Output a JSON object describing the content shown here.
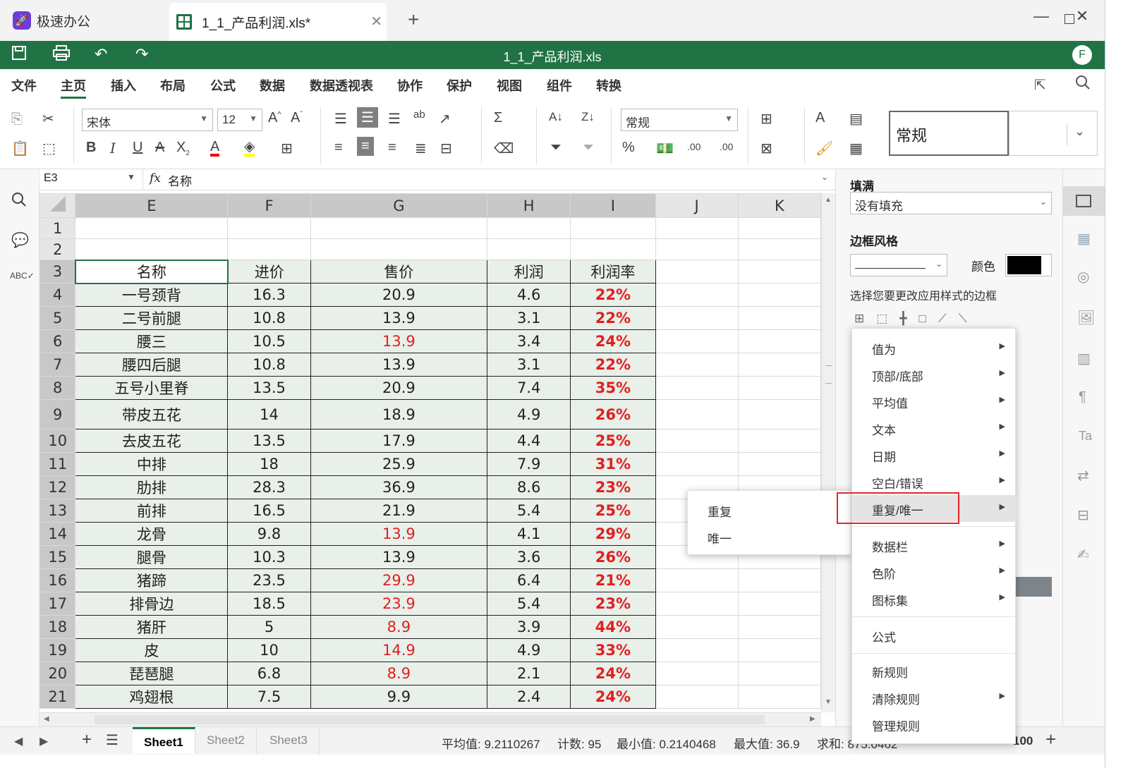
{
  "tabs": {
    "app_name": "极速办公",
    "doc_name": "1_1_产品利润.xls*"
  },
  "titlebar": {
    "title": "1_1_产品利润.xls",
    "avatar": "F"
  },
  "menu": [
    "文件",
    "主页",
    "插入",
    "布局",
    "公式",
    "数据",
    "数据透视表",
    "协作",
    "保护",
    "视图",
    "组件",
    "转换"
  ],
  "ribbon": {
    "font_name": "宋体",
    "font_size": "12",
    "number_format": "常规",
    "style_preview": "常规"
  },
  "formula_bar": {
    "cell_ref": "E3",
    "fx": "fx",
    "value": "名称"
  },
  "grid": {
    "columns": [
      "E",
      "F",
      "G",
      "H",
      "I",
      "J",
      "K"
    ],
    "rows": [
      {
        "n": "1",
        "cells": [
          "",
          "",
          "",
          "",
          ""
        ]
      },
      {
        "n": "2",
        "cells": [
          "",
          "",
          "",
          "",
          ""
        ]
      },
      {
        "n": "3",
        "cells": [
          "名称",
          "进价",
          "售价",
          "利润",
          "利润率"
        ]
      },
      {
        "n": "4",
        "cells": [
          "一号颈背",
          "16.3",
          "20.9",
          "4.6",
          "22%"
        ]
      },
      {
        "n": "5",
        "cells": [
          "二号前腿",
          "10.8",
          "13.9",
          "3.1",
          "22%"
        ]
      },
      {
        "n": "6",
        "cells": [
          "腰三",
          "10.5",
          "13.9",
          "3.4",
          "24%"
        ]
      },
      {
        "n": "7",
        "cells": [
          "腰四后腿",
          "10.8",
          "13.9",
          "3.1",
          "22%"
        ]
      },
      {
        "n": "8",
        "cells": [
          "五号小里脊",
          "13.5",
          "20.9",
          "7.4",
          "35%"
        ]
      },
      {
        "n": "9",
        "cells": [
          "带皮五花",
          "14",
          "18.9",
          "4.9",
          "26%"
        ]
      },
      {
        "n": "10",
        "cells": [
          "去皮五花",
          "13.5",
          "17.9",
          "4.4",
          "25%"
        ]
      },
      {
        "n": "11",
        "cells": [
          "中排",
          "18",
          "25.9",
          "7.9",
          "31%"
        ]
      },
      {
        "n": "12",
        "cells": [
          "肋排",
          "28.3",
          "36.9",
          "8.6",
          "23%"
        ]
      },
      {
        "n": "13",
        "cells": [
          "前排",
          "16.5",
          "21.9",
          "5.4",
          "25%"
        ]
      },
      {
        "n": "14",
        "cells": [
          "龙骨",
          "9.8",
          "13.9",
          "4.1",
          "29%"
        ]
      },
      {
        "n": "15",
        "cells": [
          "腿骨",
          "10.3",
          "13.9",
          "3.6",
          "26%"
        ]
      },
      {
        "n": "16",
        "cells": [
          "猪蹄",
          "23.5",
          "29.9",
          "6.4",
          "21%"
        ]
      },
      {
        "n": "17",
        "cells": [
          "排骨边",
          "18.5",
          "23.9",
          "5.4",
          "23%"
        ]
      },
      {
        "n": "18",
        "cells": [
          "猪肝",
          "5",
          "8.9",
          "3.9",
          "44%"
        ]
      },
      {
        "n": "19",
        "cells": [
          "皮",
          "10",
          "14.9",
          "4.9",
          "33%"
        ]
      },
      {
        "n": "20",
        "cells": [
          "琵琶腿",
          "6.8",
          "8.9",
          "2.1",
          "24%"
        ]
      },
      {
        "n": "21",
        "cells": [
          "鸡翅根",
          "7.5",
          "9.9",
          "2.4",
          "24%"
        ]
      }
    ],
    "red_price_rows": [
      "6",
      "14",
      "16",
      "17",
      "18",
      "19",
      "20"
    ]
  },
  "right_panel": {
    "fill_label": "填满",
    "fill_value": "没有填充",
    "border_style_label": "边框风格",
    "color_label": "颜色",
    "border_hint": "选择您要更改应用样式的边框"
  },
  "context_menu": {
    "items": [
      "值为",
      "顶部/底部",
      "平均值",
      "文本",
      "日期",
      "空白/错误",
      "重复/唯一",
      "数据栏",
      "色阶",
      "图标集",
      "公式",
      "新规则",
      "清除规则",
      "管理规则"
    ],
    "submenu": [
      "重复",
      "唯一"
    ]
  },
  "sheets": [
    "Sheet1",
    "Sheet2",
    "Sheet3"
  ],
  "status": {
    "average": "平均值: 9.2110267",
    "count": "计数: 95",
    "min": "最小值: 0.2140468",
    "max": "最大值: 36.9",
    "sum": "求和: 875.0462",
    "zoom": "100"
  },
  "colors": {
    "brand_green": "#217346",
    "accent_red": "#e02020"
  }
}
